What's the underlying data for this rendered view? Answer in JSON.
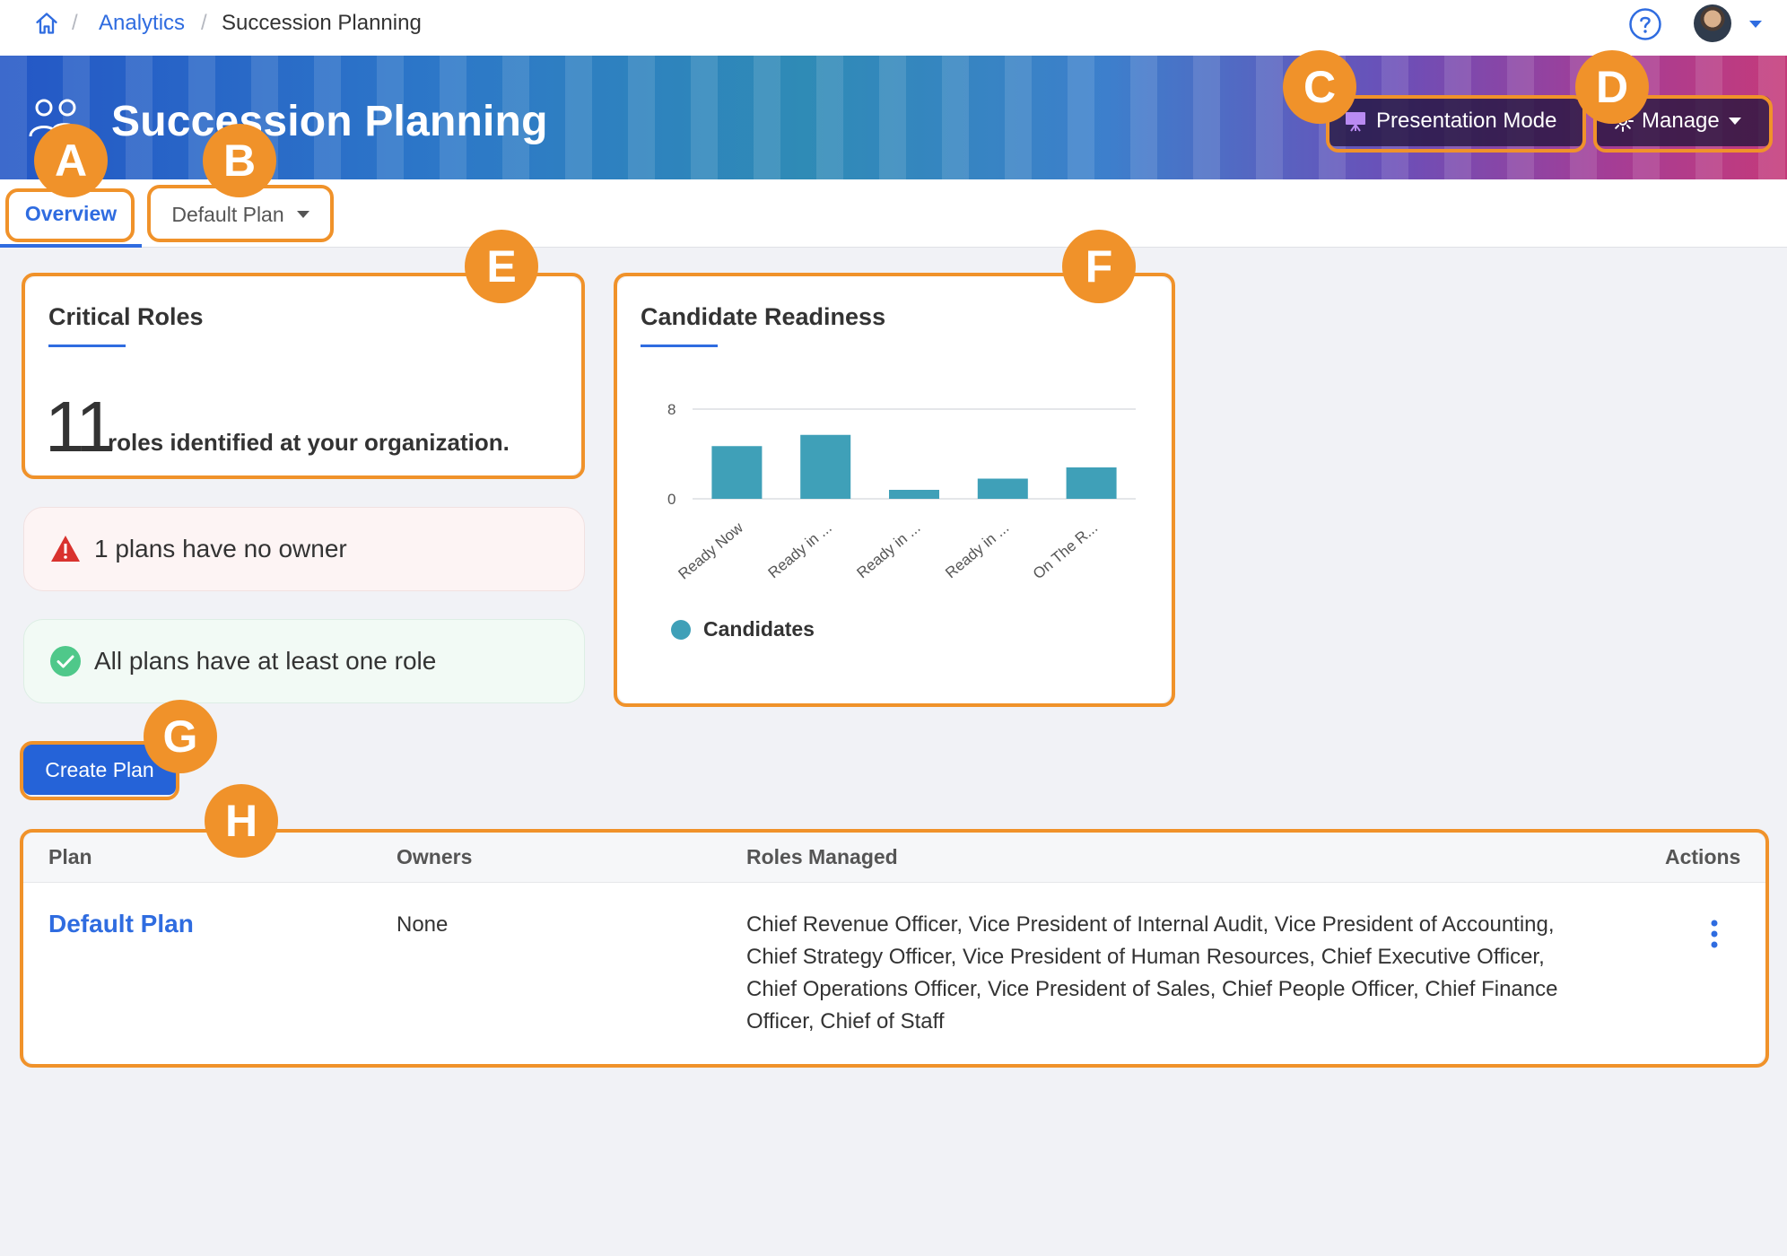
{
  "breadcrumb": {
    "separator": "/",
    "parent": "Analytics",
    "current": "Succession Planning"
  },
  "header": {
    "title": "Succession Planning",
    "presentation_label": "Presentation Mode",
    "manage_label": "Manage"
  },
  "tabs": {
    "overview": "Overview",
    "plan_selector": "Default Plan"
  },
  "critical_roles": {
    "title": "Critical Roles",
    "count": "11",
    "text": "roles identified at your organization."
  },
  "alerts": {
    "warning": "1 plans have no owner",
    "success": "All plans have at least one role"
  },
  "readiness": {
    "title": "Candidate Readiness",
    "legend": "Candidates"
  },
  "chart_data": {
    "type": "bar",
    "categories": [
      "Ready Now",
      "Ready in ...",
      "Ready in ...",
      "Ready in ...",
      "On The R..."
    ],
    "series": [
      {
        "name": "Candidates",
        "values": [
          4.7,
          5.7,
          0.8,
          1.8,
          2.8
        ]
      }
    ],
    "ylim": [
      0,
      8
    ],
    "yticks": [
      "0",
      "8"
    ],
    "legend": "bottom-left",
    "color": "#3fa0b8"
  },
  "actions": {
    "create_plan": "Create Plan"
  },
  "table": {
    "headers": {
      "plan": "Plan",
      "owners": "Owners",
      "roles": "Roles Managed",
      "actions": "Actions"
    },
    "rows": [
      {
        "plan": "Default Plan",
        "owners": "None",
        "roles": "Chief Revenue Officer, Vice President of Internal Audit, Vice President of Accounting, Chief Strategy Officer, Vice President of Human Resources, Chief Executive Officer, Chief Operations Officer, Vice President of Sales, Chief People Officer, Chief Finance Officer, Chief of Staff"
      }
    ]
  },
  "callouts": {
    "a": "A",
    "b": "B",
    "c": "C",
    "d": "D",
    "e": "E",
    "f": "F",
    "g": "G",
    "h": "H"
  },
  "colors": {
    "accent": "#2f6ce0",
    "callout": "#f0922a",
    "bar": "#3fa0b8"
  }
}
